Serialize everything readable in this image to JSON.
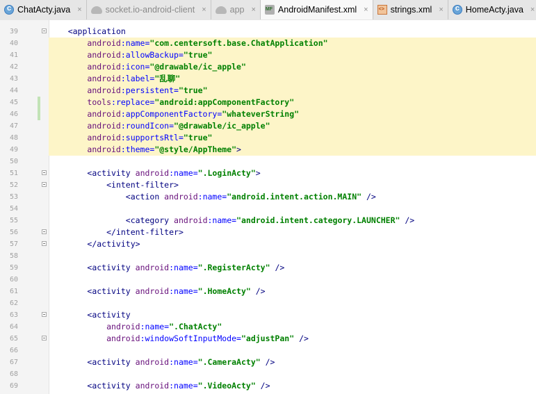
{
  "tabs": [
    {
      "label": "ChatActy.java",
      "icon": "java-class-icon",
      "active": false,
      "dim": false
    },
    {
      "label": "socket.io-android-client",
      "icon": "android-module-icon",
      "active": false,
      "dim": true
    },
    {
      "label": "app",
      "icon": "android-module-icon",
      "active": false,
      "dim": true
    },
    {
      "label": "AndroidManifest.xml",
      "icon": "manifest-file-icon",
      "active": true,
      "dim": false
    },
    {
      "label": "strings.xml",
      "icon": "xml-file-icon",
      "active": false,
      "dim": false
    },
    {
      "label": "HomeActy.java",
      "icon": "java-class-icon",
      "active": false,
      "dim": false
    }
  ],
  "close_glyph": "×",
  "lines": [
    {
      "n": "39",
      "segs": [
        [
          "p",
          "    "
        ],
        [
          "t",
          "<application"
        ]
      ],
      "hl": false,
      "fold": true
    },
    {
      "n": "40",
      "segs": [
        [
          "p",
          "        "
        ],
        [
          "n",
          "android"
        ],
        [
          "a",
          ":name="
        ],
        [
          "v",
          "\"com.centersoft.base.ChatApplication\""
        ]
      ],
      "hl": true
    },
    {
      "n": "41",
      "segs": [
        [
          "p",
          "        "
        ],
        [
          "n",
          "android"
        ],
        [
          "a",
          ":allowBackup="
        ],
        [
          "v",
          "\"true\""
        ]
      ],
      "hl": true
    },
    {
      "n": "42",
      "segs": [
        [
          "p",
          "        "
        ],
        [
          "n",
          "android"
        ],
        [
          "a",
          ":icon="
        ],
        [
          "v",
          "\"@drawable/ic_apple\""
        ]
      ],
      "hl": true
    },
    {
      "n": "43",
      "segs": [
        [
          "p",
          "        "
        ],
        [
          "n",
          "android"
        ],
        [
          "a",
          ":label="
        ],
        [
          "v",
          "\"乱聊\""
        ]
      ],
      "hl": true
    },
    {
      "n": "44",
      "segs": [
        [
          "p",
          "        "
        ],
        [
          "n",
          "android"
        ],
        [
          "a",
          ":persistent="
        ],
        [
          "v",
          "\"true\""
        ]
      ],
      "hl": true
    },
    {
      "n": "45",
      "segs": [
        [
          "p",
          "        "
        ],
        [
          "n",
          "tools"
        ],
        [
          "a",
          ":replace="
        ],
        [
          "v",
          "\"android:appComponentFactory\""
        ]
      ],
      "hl": true,
      "changed": true
    },
    {
      "n": "46",
      "segs": [
        [
          "p",
          "        "
        ],
        [
          "n",
          "android"
        ],
        [
          "a",
          ":appComponentFactory="
        ],
        [
          "v",
          "\"whateverString\""
        ]
      ],
      "hl": true,
      "changed": true
    },
    {
      "n": "47",
      "segs": [
        [
          "p",
          "        "
        ],
        [
          "n",
          "android"
        ],
        [
          "a",
          ":roundIcon="
        ],
        [
          "v",
          "\"@drawable/ic_apple\""
        ]
      ],
      "hl": true,
      "current": true
    },
    {
      "n": "48",
      "segs": [
        [
          "p",
          "        "
        ],
        [
          "n",
          "android"
        ],
        [
          "a",
          ":supportsRtl="
        ],
        [
          "v",
          "\"true\""
        ]
      ],
      "hl": true
    },
    {
      "n": "49",
      "segs": [
        [
          "p",
          "        "
        ],
        [
          "n",
          "android"
        ],
        [
          "a",
          ":theme="
        ],
        [
          "v",
          "\"@style/AppTheme\""
        ],
        [
          "t",
          ">"
        ]
      ],
      "hl": true
    },
    {
      "n": "50",
      "segs": [],
      "hl": false
    },
    {
      "n": "51",
      "segs": [
        [
          "p",
          "        "
        ],
        [
          "t",
          "<activity "
        ],
        [
          "n",
          "android"
        ],
        [
          "a",
          ":name="
        ],
        [
          "v",
          "\".LoginActy\""
        ],
        [
          "t",
          ">"
        ]
      ],
      "hl": false,
      "fold": true
    },
    {
      "n": "52",
      "segs": [
        [
          "p",
          "            "
        ],
        [
          "t",
          "<intent-filter>"
        ]
      ],
      "hl": false,
      "fold": true
    },
    {
      "n": "53",
      "segs": [
        [
          "p",
          "                "
        ],
        [
          "t",
          "<action "
        ],
        [
          "n",
          "android"
        ],
        [
          "a",
          ":name="
        ],
        [
          "v",
          "\"android.intent.action.MAIN\""
        ],
        [
          "t",
          " />"
        ]
      ],
      "hl": false
    },
    {
      "n": "54",
      "segs": [],
      "hl": false
    },
    {
      "n": "55",
      "segs": [
        [
          "p",
          "                "
        ],
        [
          "t",
          "<category "
        ],
        [
          "n",
          "android"
        ],
        [
          "a",
          ":name="
        ],
        [
          "v",
          "\"android.intent.category.LAUNCHER\""
        ],
        [
          "t",
          " />"
        ]
      ],
      "hl": false
    },
    {
      "n": "56",
      "segs": [
        [
          "p",
          "            "
        ],
        [
          "t",
          "</intent-filter>"
        ]
      ],
      "hl": false,
      "fold": true
    },
    {
      "n": "57",
      "segs": [
        [
          "p",
          "        "
        ],
        [
          "t",
          "</activity>"
        ]
      ],
      "hl": false,
      "fold": true
    },
    {
      "n": "58",
      "segs": [],
      "hl": false
    },
    {
      "n": "59",
      "segs": [
        [
          "p",
          "        "
        ],
        [
          "t",
          "<activity "
        ],
        [
          "n",
          "android"
        ],
        [
          "a",
          ":name="
        ],
        [
          "v",
          "\".RegisterActy\""
        ],
        [
          "t",
          " />"
        ]
      ],
      "hl": false
    },
    {
      "n": "60",
      "segs": [],
      "hl": false
    },
    {
      "n": "61",
      "segs": [
        [
          "p",
          "        "
        ],
        [
          "t",
          "<activity "
        ],
        [
          "n",
          "android"
        ],
        [
          "a",
          ":name="
        ],
        [
          "v",
          "\".HomeActy\""
        ],
        [
          "t",
          " />"
        ]
      ],
      "hl": false
    },
    {
      "n": "62",
      "segs": [],
      "hl": false
    },
    {
      "n": "63",
      "segs": [
        [
          "p",
          "        "
        ],
        [
          "t",
          "<activity"
        ]
      ],
      "hl": false,
      "fold": true
    },
    {
      "n": "64",
      "segs": [
        [
          "p",
          "            "
        ],
        [
          "n",
          "android"
        ],
        [
          "a",
          ":name="
        ],
        [
          "v",
          "\".ChatActy\""
        ]
      ],
      "hl": false
    },
    {
      "n": "65",
      "segs": [
        [
          "p",
          "            "
        ],
        [
          "n",
          "android"
        ],
        [
          "a",
          ":windowSoftInputMode="
        ],
        [
          "v",
          "\"adjustPan\""
        ],
        [
          "t",
          " />"
        ]
      ],
      "hl": false,
      "fold": true
    },
    {
      "n": "66",
      "segs": [],
      "hl": false
    },
    {
      "n": "67",
      "segs": [
        [
          "p",
          "        "
        ],
        [
          "t",
          "<activity "
        ],
        [
          "n",
          "android"
        ],
        [
          "a",
          ":name="
        ],
        [
          "v",
          "\".CameraActy\""
        ],
        [
          "t",
          " />"
        ]
      ],
      "hl": false
    },
    {
      "n": "68",
      "segs": [],
      "hl": false
    },
    {
      "n": "69",
      "segs": [
        [
          "p",
          "        "
        ],
        [
          "t",
          "<activity "
        ],
        [
          "n",
          "android"
        ],
        [
          "a",
          ":name="
        ],
        [
          "v",
          "\".VideoActy\""
        ],
        [
          "t",
          " />"
        ]
      ],
      "hl": false
    }
  ],
  "annotation": {
    "box_color": "#e0282e",
    "arrow_color": "#21a833",
    "arrow_icon": "green-left-arrow"
  },
  "colors": {
    "tag": "#000080",
    "namespace": "#660e7a",
    "attribute": "#0000ff",
    "value": "#008000",
    "highlight_bg": "#fdf5c8"
  }
}
